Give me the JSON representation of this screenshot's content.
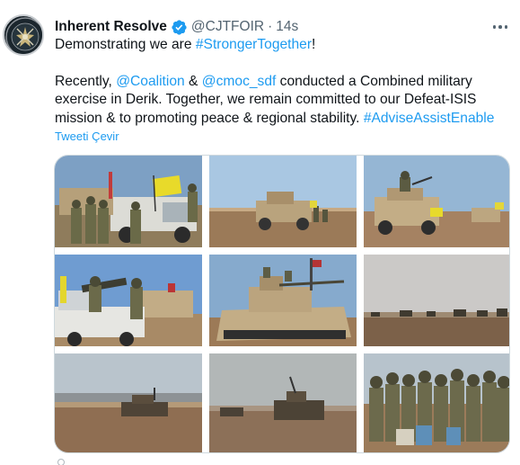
{
  "tweet": {
    "author_name": "Inherent Resolve",
    "handle": "@CJTFOIR",
    "separator": "·",
    "time": "14s",
    "text_line1_prefix": "Demonstrating we are ",
    "hashtag1": "#StrongerTogether",
    "text_line1_suffix": "!",
    "text_p2_a": "Recently, ",
    "mention1": "@Coalition",
    "text_p2_b": " & ",
    "mention2": "@cmoc_sdf",
    "text_p2_c": " conducted a Combined military exercise in Derik. Together, we remain committed to our Defeat-ISIS mission & to promoting peace & regional stability. ",
    "hashtag2": "#AdviseAssistEnable",
    "translate_label": "Tweeti Çevir"
  },
  "icons": {
    "avatar": "cjtf-oir-emblem",
    "verified": "verified-badge-icon",
    "more": "more-options-icon"
  },
  "colors": {
    "link": "#1d9bf0",
    "secondary_text": "#536471",
    "primary_text": "#0f1419"
  },
  "photos": [
    {
      "id": "photo-1",
      "subject": "soldiers with pickup truck and yellow flag"
    },
    {
      "id": "photo-2",
      "subject": "armored vehicle in desert"
    },
    {
      "id": "photo-3",
      "subject": "armored vehicle with gunner and yellow flag"
    },
    {
      "id": "photo-4",
      "subject": "pickup truck with mounted gun and soldiers"
    },
    {
      "id": "photo-5",
      "subject": "bradley fighting vehicle close-up"
    },
    {
      "id": "photo-6",
      "subject": "vehicles in distance across field"
    },
    {
      "id": "photo-7",
      "subject": "armored vehicle on hill"
    },
    {
      "id": "photo-8",
      "subject": "armored vehicles on dusty field"
    },
    {
      "id": "photo-9",
      "subject": "group of soldiers posing"
    }
  ]
}
